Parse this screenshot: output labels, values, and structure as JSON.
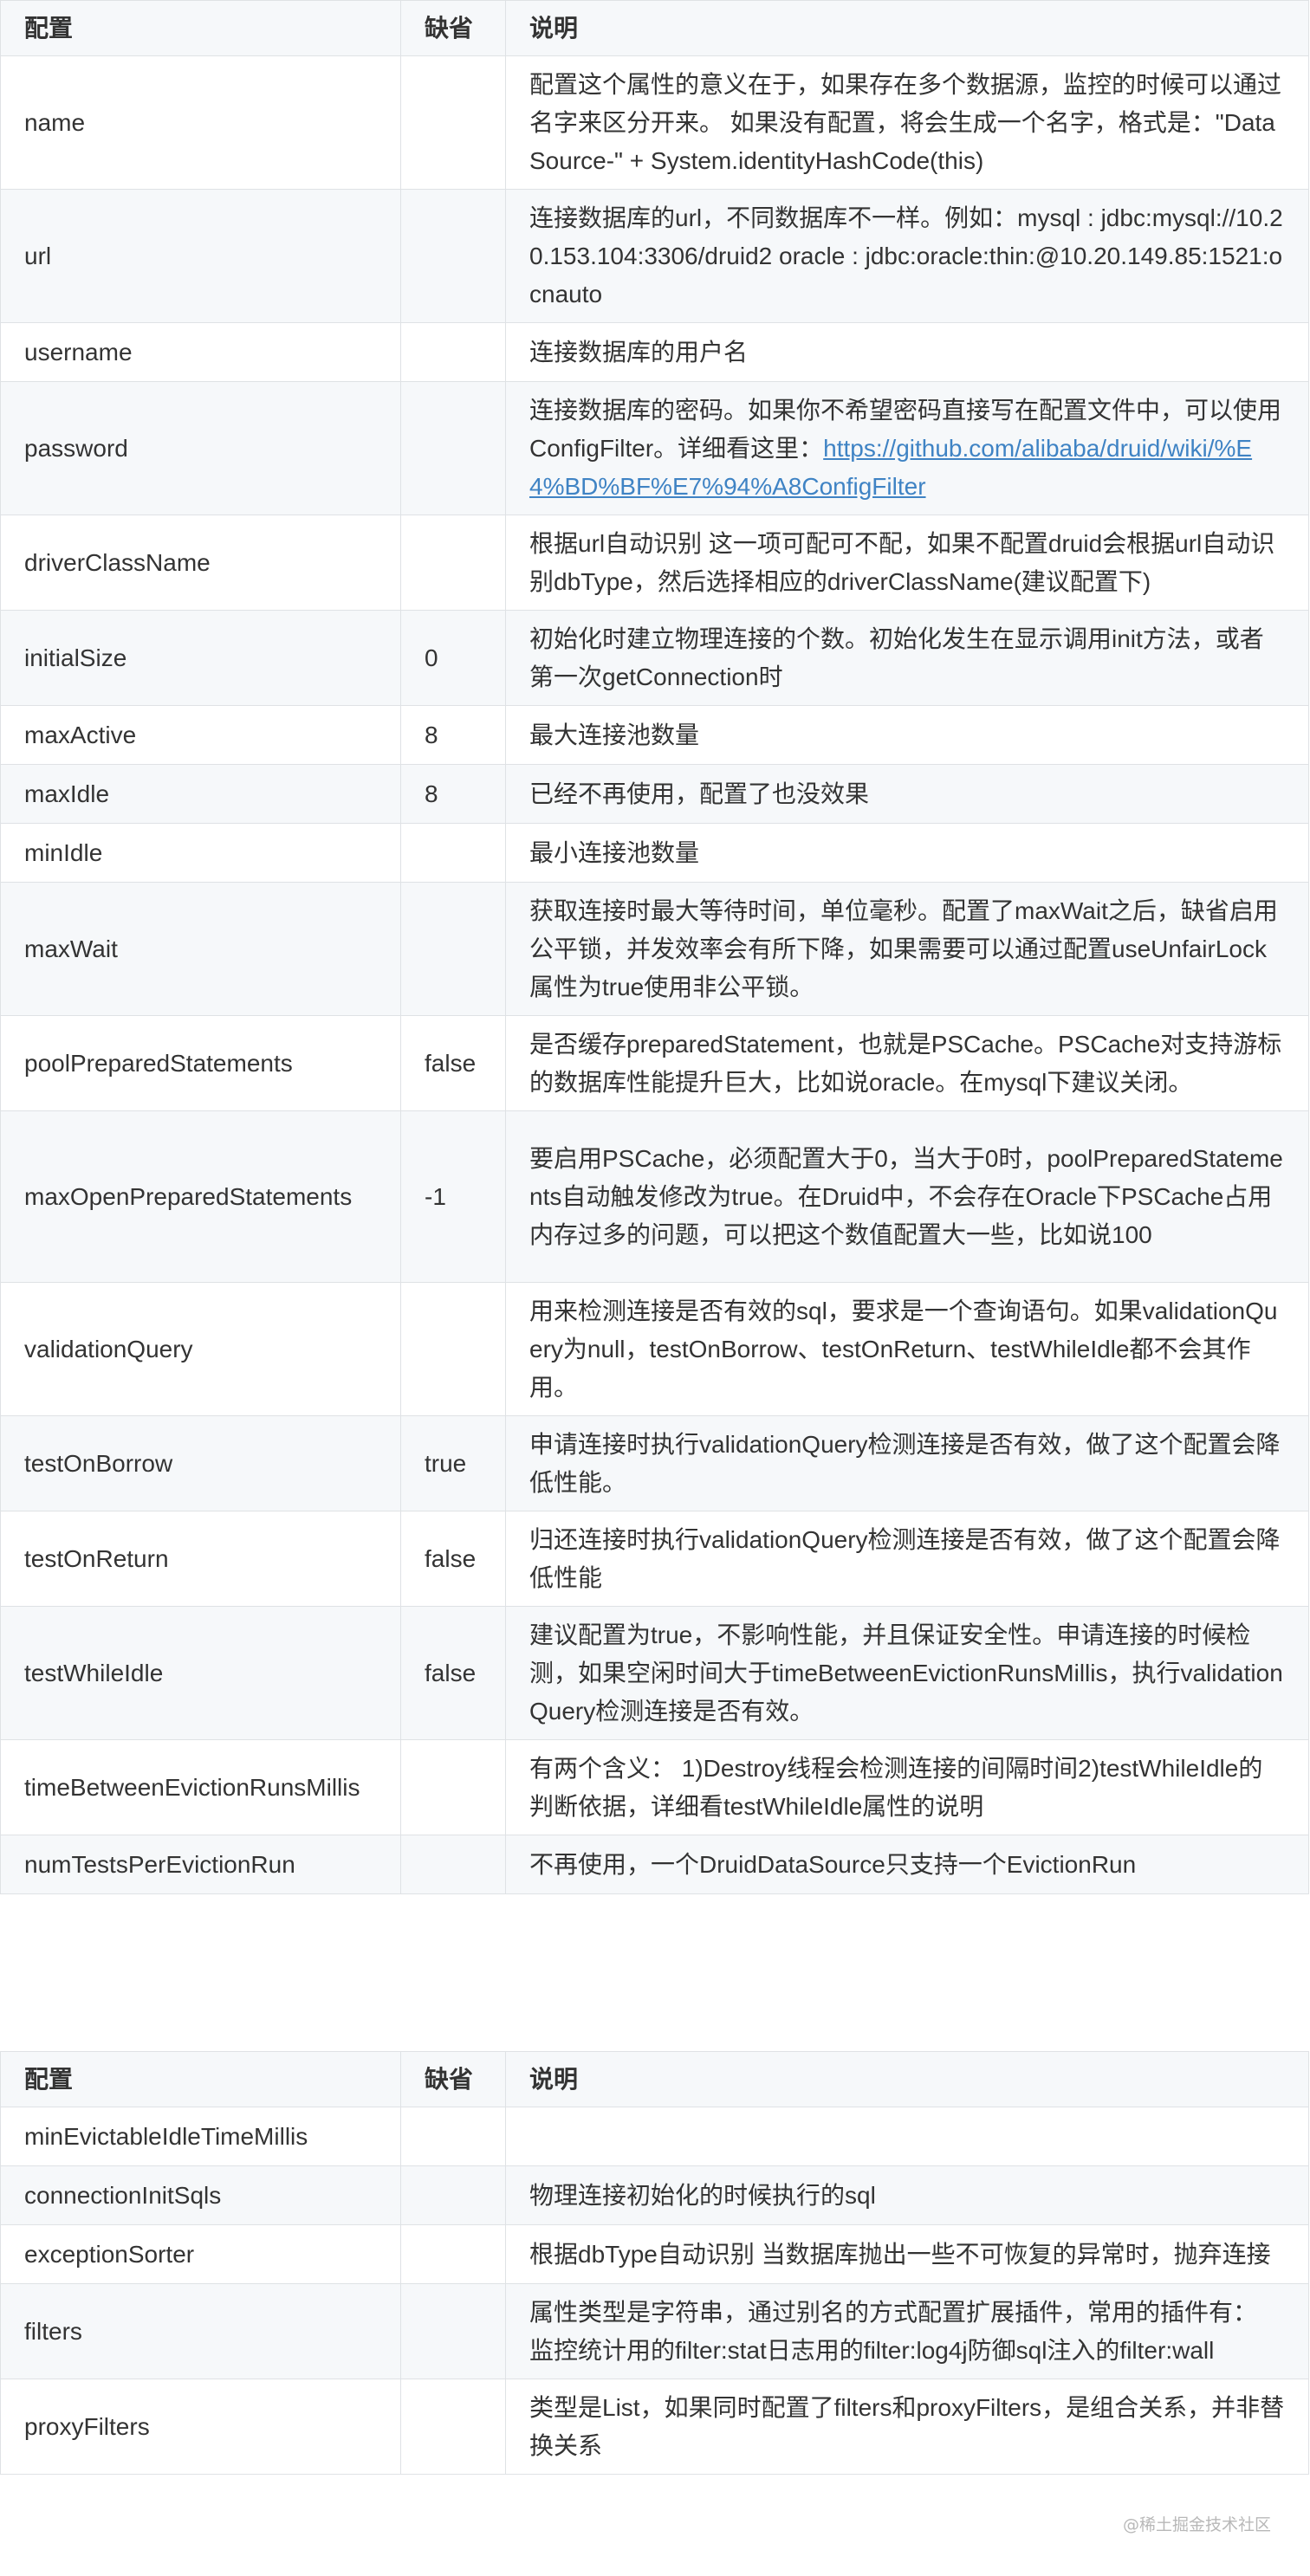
{
  "headers": {
    "config": "配置",
    "default": "缺省",
    "description": "说明"
  },
  "table1": [
    {
      "name": "name",
      "default": "",
      "desc": "配置这个属性的意义在于，如果存在多个数据源，监控的时候可以通过名字来区分开来。 如果没有配置，将会生成一个名字，格式是：\"DataSource-\" + System.identityHashCode(this)"
    },
    {
      "name": "url",
      "default": "",
      "desc": "连接数据库的url，不同数据库不一样。例如：mysql : jdbc:mysql://10.20.153.104:3306/druid2 oracle : jdbc:oracle:thin:@10.20.149.85:1521:ocnauto"
    },
    {
      "name": "username",
      "default": "",
      "desc": "连接数据库的用户名"
    },
    {
      "name": "password",
      "default": "",
      "desc": "连接数据库的密码。如果你不希望密码直接写在配置文件中，可以使用ConfigFilter。详细看这里：",
      "link": "https://github.com/alibaba/druid/wiki/%E4%BD%BF%E7%94%A8ConfigFilter"
    },
    {
      "name": "driverClassName",
      "default": "",
      "desc": "根据url自动识别 这一项可配可不配，如果不配置druid会根据url自动识别dbType，然后选择相应的driverClassName(建议配置下)"
    },
    {
      "name": "initialSize",
      "default": "0",
      "desc": "初始化时建立物理连接的个数。初始化发生在显示调用init方法，或者第一次getConnection时"
    },
    {
      "name": "maxActive",
      "default": "8",
      "desc": "最大连接池数量"
    },
    {
      "name": "maxIdle",
      "default": "8",
      "desc": "已经不再使用，配置了也没效果"
    },
    {
      "name": "minIdle",
      "default": "",
      "desc": "最小连接池数量"
    },
    {
      "name": "maxWait",
      "default": "",
      "desc": "获取连接时最大等待时间，单位毫秒。配置了maxWait之后，缺省启用公平锁，并发效率会有所下降，如果需要可以通过配置useUnfairLock属性为true使用非公平锁。"
    },
    {
      "name": "poolPreparedStatements",
      "default": "false",
      "desc": "是否缓存preparedStatement，也就是PSCache。PSCache对支持游标的数据库性能提升巨大，比如说oracle。在mysql下建议关闭。"
    },
    {
      "name": "maxOpenPreparedStatements",
      "default": "-1",
      "desc": "要启用PSCache，必须配置大于0，当大于0时，poolPreparedStatements自动触发修改为true。在Druid中，不会存在Oracle下PSCache占用内存过多的问题，可以把这个数值配置大一些，比如说100"
    },
    {
      "name": "validationQuery",
      "default": "",
      "desc": "用来检测连接是否有效的sql，要求是一个查询语句。如果validationQuery为null，testOnBorrow、testOnReturn、testWhileIdle都不会其作用。"
    },
    {
      "name": "testOnBorrow",
      "default": "true",
      "desc": "申请连接时执行validationQuery检测连接是否有效，做了这个配置会降低性能。"
    },
    {
      "name": "testOnReturn",
      "default": "false",
      "desc": "归还连接时执行validationQuery检测连接是否有效，做了这个配置会降低性能"
    },
    {
      "name": "testWhileIdle",
      "default": "false",
      "desc": "建议配置为true，不影响性能，并且保证安全性。申请连接的时候检测，如果空闲时间大于timeBetweenEvictionRunsMillis，执行validationQuery检测连接是否有效。"
    },
    {
      "name": "timeBetweenEvictionRunsMillis",
      "default": "",
      "desc": "有两个含义： 1)Destroy线程会检测连接的间隔时间2)testWhileIdle的判断依据，详细看testWhileIdle属性的说明"
    },
    {
      "name": "numTestsPerEvictionRun",
      "default": "",
      "desc": "不再使用，一个DruidDataSource只支持一个EvictionRun"
    }
  ],
  "table2": [
    {
      "name": "minEvictableIdleTimeMillis",
      "default": "",
      "desc": ""
    },
    {
      "name": "connectionInitSqls",
      "default": "",
      "desc": "物理连接初始化的时候执行的sql"
    },
    {
      "name": "exceptionSorter",
      "default": "",
      "desc": "根据dbType自动识别 当数据库抛出一些不可恢复的异常时，抛弃连接"
    },
    {
      "name": "filters",
      "default": "",
      "desc": "属性类型是字符串，通过别名的方式配置扩展插件，常用的插件有： 监控统计用的filter:stat日志用的filter:log4j防御sql注入的filter:wall"
    },
    {
      "name": "proxyFilters",
      "default": "",
      "desc": "类型是List，如果同时配置了filters和proxyFilters，是组合关系，并非替换关系"
    }
  ],
  "watermark": "@稀土掘金技术社区",
  "colors": {
    "link": "#3f83c4",
    "border": "#dfe2e5",
    "stripe": "#f6f8fa",
    "text": "#333333"
  }
}
